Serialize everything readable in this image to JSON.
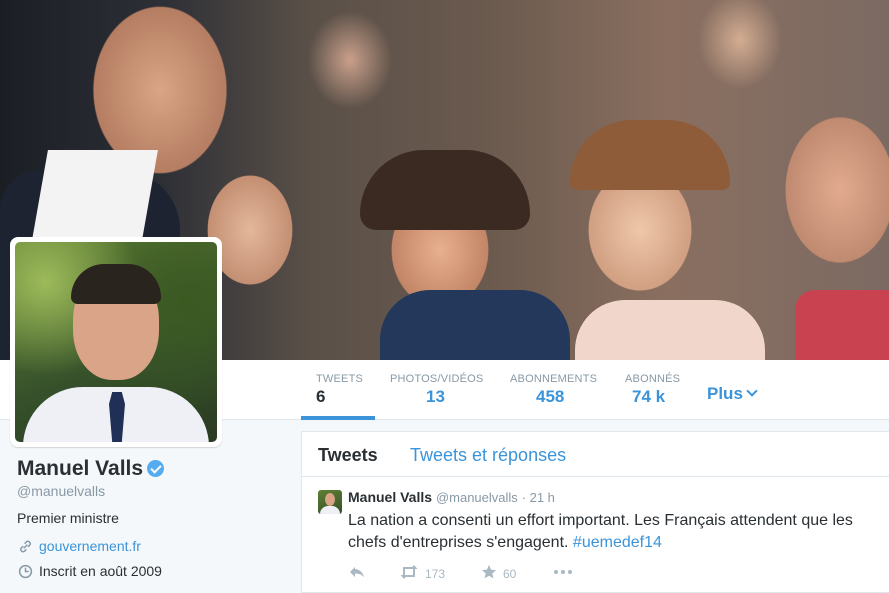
{
  "profile": {
    "name": "Manuel Valls",
    "handle": "@manuelvalls",
    "bio": "Premier ministre",
    "website": "gouvernement.fr",
    "joined": "Inscrit en août 2009"
  },
  "nav": {
    "items": [
      {
        "label": "TWEETS",
        "value": "6"
      },
      {
        "label": "PHOTOS/VIDÉOS",
        "value": "13"
      },
      {
        "label": "ABONNEMENTS",
        "value": "458"
      },
      {
        "label": "ABONNÉS",
        "value": "74 k"
      }
    ],
    "more": "Plus"
  },
  "tabs": {
    "tweets": "Tweets",
    "replies": "Tweets et réponses"
  },
  "tweet": {
    "name": "Manuel Valls",
    "handle": "@manuelvalls",
    "time": "· 21 h",
    "text": "La nation a consenti un effort important. Les Français attendent que les chefs d'entreprises s'engagent. ",
    "hashtag": "#uemedef14",
    "retweets": "173",
    "favorites": "60"
  },
  "colors": {
    "accent": "#3b94d9",
    "verified": "#55acee"
  }
}
